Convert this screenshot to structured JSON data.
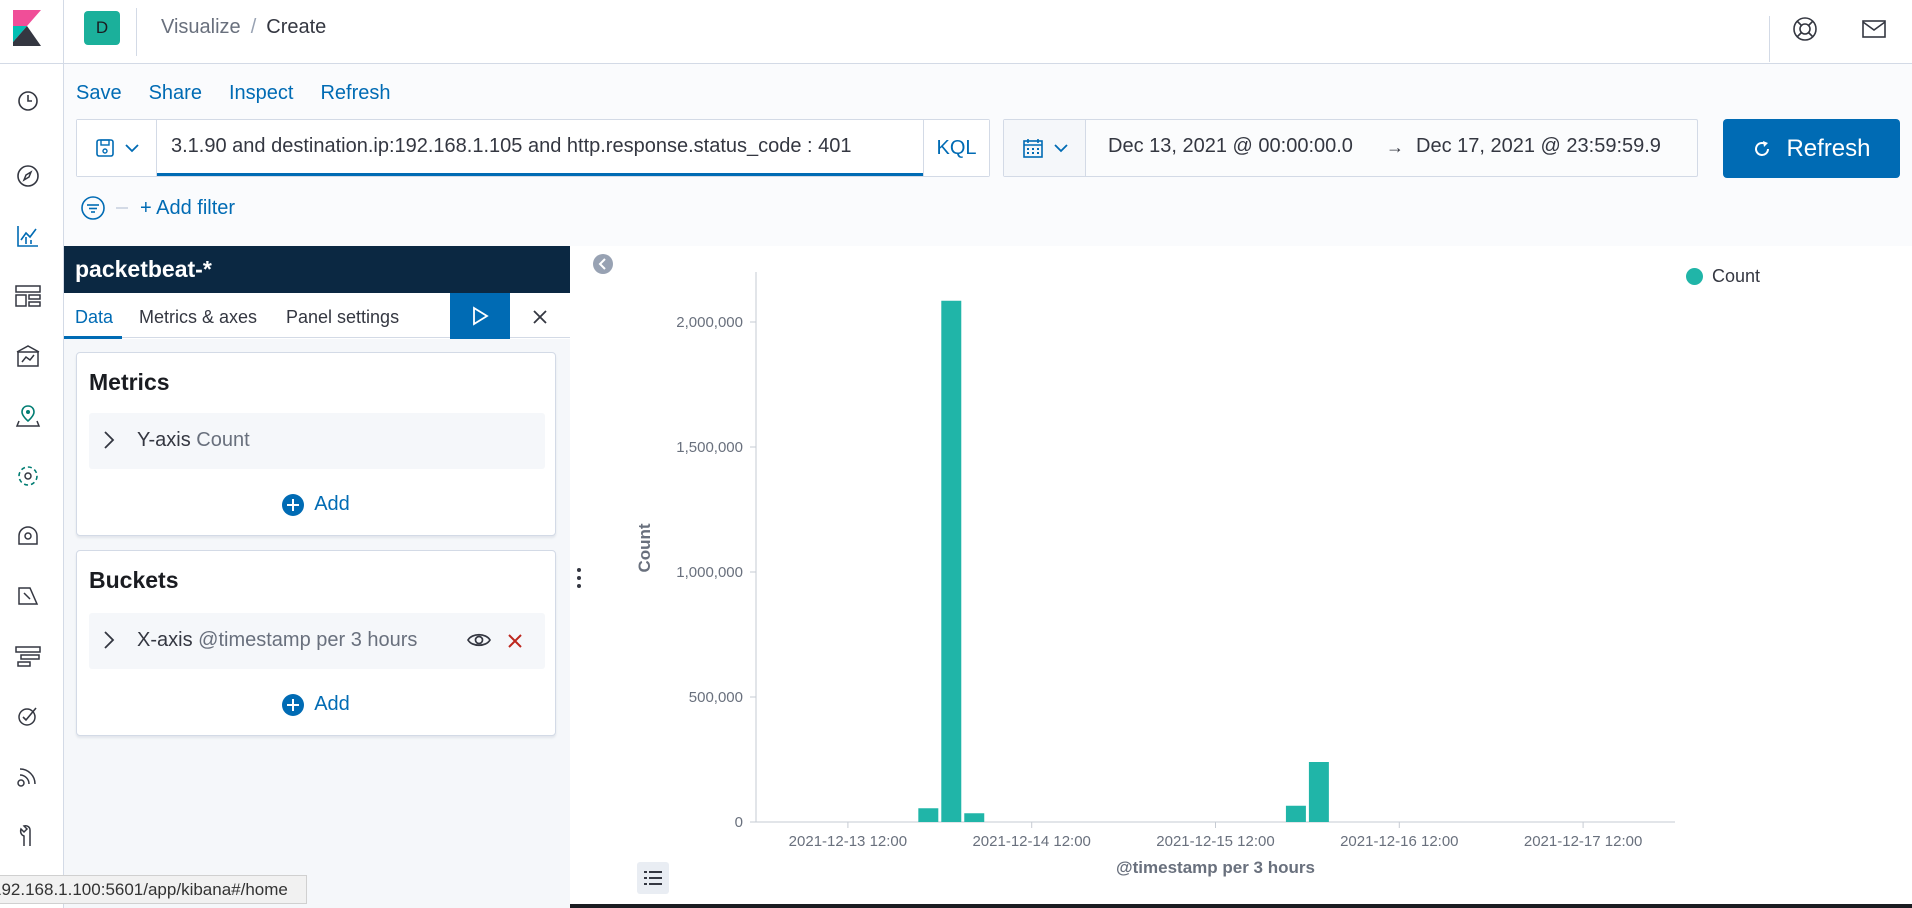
{
  "header": {
    "space_initial": "D",
    "breadcrumbs": [
      "Visualize",
      "Create"
    ],
    "breadcrumb_sep": "/"
  },
  "top_menu": [
    "Save",
    "Share",
    "Inspect",
    "Refresh"
  ],
  "query": {
    "text": "3.1.90 and destination.ip:192.168.1.105 and http.response.status_code : 401",
    "language": "KQL"
  },
  "time": {
    "start": "Dec 13, 2021 @ 00:00:00.0",
    "arrow": "→",
    "end": "Dec 17, 2021 @ 23:59:59.9",
    "refresh_label": "Refresh"
  },
  "filters": {
    "add_label": "+ Add filter"
  },
  "editor": {
    "index_pattern": "packetbeat-*",
    "tabs": [
      "Data",
      "Metrics & axes",
      "Panel settings"
    ],
    "active_tab": "Data",
    "metrics": {
      "title": "Metrics",
      "row_label": "Y-axis",
      "row_sub": "Count",
      "add_label": "Add"
    },
    "buckets": {
      "title": "Buckets",
      "row_label": "X-axis",
      "row_sub": "@timestamp per 3 hours",
      "add_label": "Add"
    }
  },
  "status_url": "192.168.1.100:5601/app/kibana#/home",
  "colors": {
    "accent": "#006bb4",
    "bar": "#20b5a8",
    "header_dark": "#0b2842",
    "danger": "#bd271e"
  },
  "chart_data": {
    "type": "bar",
    "title": "",
    "xlabel": "@timestamp per 3 hours",
    "ylabel": "Count",
    "legend": [
      "Count"
    ],
    "legend_position": "top-right",
    "x_start": "2021-12-13 00:00",
    "x_end": "2021-12-18 00:00",
    "x_ticks": [
      "2021-12-13 12:00",
      "2021-12-14 12:00",
      "2021-12-15 12:00",
      "2021-12-16 12:00",
      "2021-12-17 12:00"
    ],
    "ylim": [
      0,
      2200000
    ],
    "y_ticks": [
      0,
      500000,
      1000000,
      1500000,
      2000000
    ],
    "y_tick_labels": [
      "0",
      "500,000",
      "1,000,000",
      "1,500,000",
      "2,000,000"
    ],
    "series": [
      {
        "name": "Count",
        "points": [
          {
            "x": "2021-12-13 21:00",
            "y": 55000
          },
          {
            "x": "2021-12-14 00:00",
            "y": 2085000
          },
          {
            "x": "2021-12-14 03:00",
            "y": 35000
          },
          {
            "x": "2021-12-15 21:00",
            "y": 65000
          },
          {
            "x": "2021-12-16 00:00",
            "y": 240000
          }
        ]
      }
    ]
  }
}
